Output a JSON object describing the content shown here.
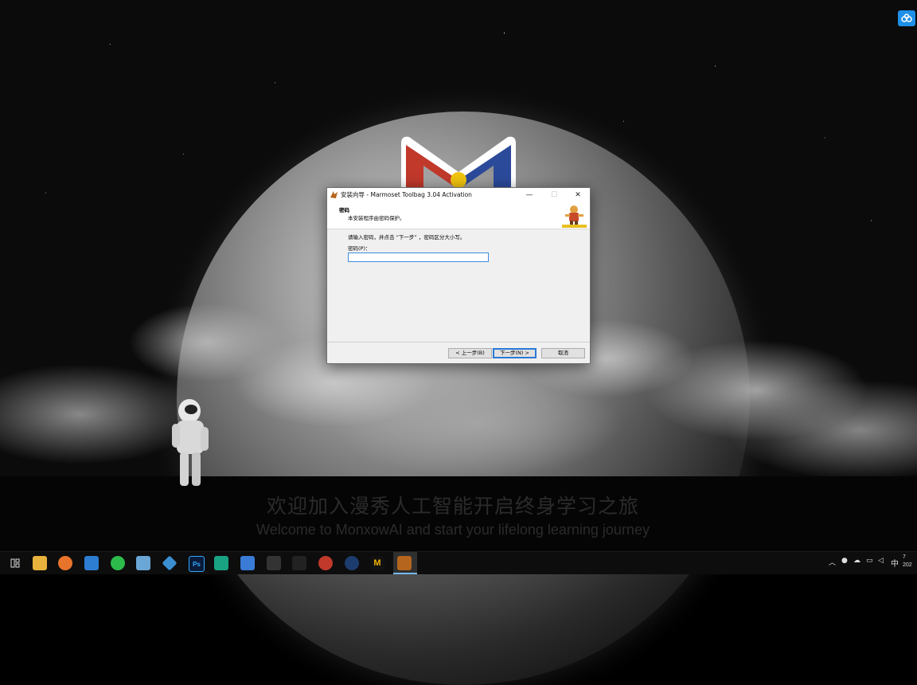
{
  "desktop": {
    "welcome_cn": "欢迎加入漫秀人工智能开启终身学习之旅",
    "welcome_en": "Welcome to MonxowAI and start your lifelong learning journey"
  },
  "dialog": {
    "title": "安装向导 - Marmoset Toolbag 3.04 Activation",
    "header_title": "密码",
    "header_subtitle": "本安装程序由密码保护。",
    "instruction": "请输入密码，并点击 “下一步” ，密码区分大小写。",
    "password_label": "密码(P)：",
    "password_value": "",
    "buttons": {
      "back": "< 上一步(B)",
      "next": "下一步(N) >",
      "cancel": "取消"
    }
  },
  "taskbar": {
    "apps": [
      "task-view",
      "file-explorer",
      "firefox",
      "browser-blue",
      "wechat",
      "photo-app",
      "3d-app",
      "photoshop",
      "substance-app",
      "sketch-app",
      "zbrush",
      "uv-app",
      "substance-painter",
      "cinema4d",
      "marmoset",
      "installer"
    ],
    "photoshop_label": "Ps",
    "marmoset_label": "M",
    "ime_label": "中",
    "clock_time": "7",
    "clock_date": "202"
  },
  "colors": {
    "taskbar": "#0d0d0d",
    "dialog_bg": "#f0f0f0",
    "accent": "#2a7ad6",
    "tray_badge": "#1e90e8"
  }
}
